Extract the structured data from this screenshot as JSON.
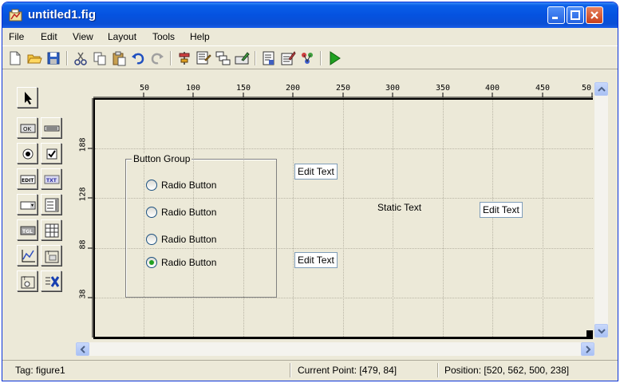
{
  "window": {
    "title": "untitled1.fig"
  },
  "menu": {
    "items": [
      "File",
      "Edit",
      "View",
      "Layout",
      "Tools",
      "Help"
    ]
  },
  "toolbar": {
    "icons": [
      "new-file-icon",
      "open-folder-icon",
      "save-icon",
      "cut-icon",
      "copy-icon",
      "paste-icon",
      "undo-icon",
      "redo-icon",
      "align-objects-icon",
      "menu-editor-icon",
      "tab-order-icon",
      "toolbar-editor-icon",
      "m-file-editor-icon",
      "property-inspector-icon",
      "object-browser-icon",
      "run-icon"
    ]
  },
  "palette": {
    "tools": [
      "select-arrow-icon",
      "push-button-icon",
      "slider-icon",
      "radio-button-icon",
      "checkbox-icon",
      "edit-text-icon",
      "static-text-icon",
      "popup-menu-icon",
      "listbox-icon",
      "toggle-button-icon",
      "table-icon",
      "axes-icon",
      "panel-icon",
      "button-group-icon",
      "activex-icon"
    ]
  },
  "ruler": {
    "top": [
      "50",
      "100",
      "150",
      "200",
      "250",
      "300",
      "350",
      "400",
      "450",
      "50"
    ],
    "left": [
      "188",
      "128",
      "88",
      "38"
    ]
  },
  "canvas": {
    "group_title": "Button Group",
    "radios": [
      {
        "label": "Radio Button",
        "selected": false
      },
      {
        "label": "Radio Button",
        "selected": false
      },
      {
        "label": "Radio Button",
        "selected": false
      },
      {
        "label": "Radio Button",
        "selected": true
      }
    ],
    "edit_texts": [
      "Edit Text",
      "Edit Text",
      "Edit Text"
    ],
    "static_text": "Static Text"
  },
  "status": {
    "tag": "Tag: figure1",
    "current_point": "Current Point:  [479, 84]",
    "position": "Position: [520, 562, 500, 238]"
  },
  "colors": {
    "titlebar": "#0552e0",
    "chrome": "#ece9d8",
    "run": "#21a121"
  }
}
